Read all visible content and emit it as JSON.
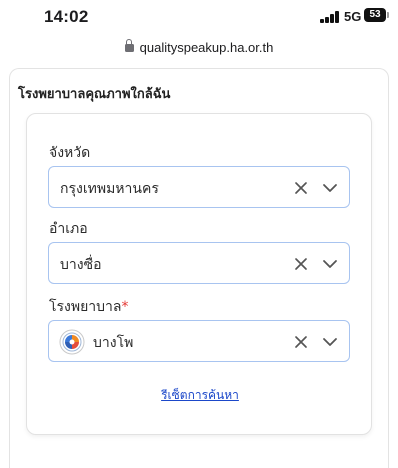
{
  "status_bar": {
    "time": "14:02",
    "network": "5G",
    "battery": "53"
  },
  "browser": {
    "url": "qualityspeakup.ha.or.th"
  },
  "section": {
    "title": "โรงพยาบาลคุณภาพใกล้ฉัน"
  },
  "form": {
    "province": {
      "label": "จังหวัด",
      "value": "กรุงเทพมหานคร"
    },
    "district": {
      "label": "อำเภอ",
      "value": "บางซื่อ"
    },
    "hospital": {
      "label": "โรงพยาบาล",
      "required_mark": "*",
      "value": "บางโพ"
    },
    "reset_label": "รีเซ็ตการค้นหา"
  },
  "colors": {
    "accent_border": "#a8c4f0",
    "link": "#1b47c9",
    "required": "#e53935"
  }
}
